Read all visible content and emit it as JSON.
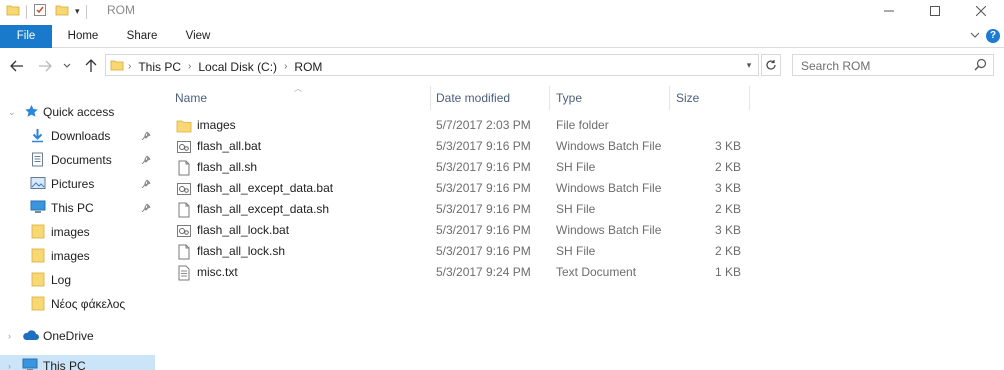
{
  "window": {
    "title": "ROM",
    "controls": [
      "minimize-icon",
      "maximize-icon",
      "close-icon"
    ]
  },
  "ribbon": {
    "tabs": [
      "File",
      "Home",
      "Share",
      "View"
    ]
  },
  "address": {
    "crumbs": [
      "This PC",
      "Local Disk (C:)",
      "ROM"
    ],
    "search_placeholder": "Search ROM"
  },
  "sidebar": {
    "items": [
      {
        "label": "Quick access",
        "icon": "star-icon",
        "pinned": false
      },
      {
        "label": "Downloads",
        "icon": "download-icon",
        "pinned": true
      },
      {
        "label": "Documents",
        "icon": "documents-icon",
        "pinned": true
      },
      {
        "label": "Pictures",
        "icon": "pictures-icon",
        "pinned": true
      },
      {
        "label": "This PC",
        "icon": "computer-icon",
        "pinned": true
      },
      {
        "label": "images",
        "icon": "folder-icon",
        "pinned": false
      },
      {
        "label": "images",
        "icon": "folder-icon",
        "pinned": false
      },
      {
        "label": "Log",
        "icon": "folder-icon",
        "pinned": false
      },
      {
        "label": "Νέος φάκελος",
        "icon": "folder-icon",
        "pinned": false
      },
      {
        "label": "OneDrive",
        "icon": "cloud-icon",
        "pinned": false
      },
      {
        "label": "This PC",
        "icon": "computer-icon",
        "pinned": false
      }
    ]
  },
  "columns": {
    "name": "Name",
    "date": "Date modified",
    "type": "Type",
    "size": "Size"
  },
  "files": [
    {
      "name": "images",
      "date": "5/7/2017 2:03 PM",
      "type": "File folder",
      "size": "",
      "icon": "folder-icon"
    },
    {
      "name": "flash_all.bat",
      "date": "5/3/2017 9:16 PM",
      "type": "Windows Batch File",
      "size": "3 KB",
      "icon": "batch-file-icon"
    },
    {
      "name": "flash_all.sh",
      "date": "5/3/2017 9:16 PM",
      "type": "SH File",
      "size": "2 KB",
      "icon": "file-icon"
    },
    {
      "name": "flash_all_except_data.bat",
      "date": "5/3/2017 9:16 PM",
      "type": "Windows Batch File",
      "size": "3 KB",
      "icon": "batch-file-icon"
    },
    {
      "name": "flash_all_except_data.sh",
      "date": "5/3/2017 9:16 PM",
      "type": "SH File",
      "size": "2 KB",
      "icon": "file-icon"
    },
    {
      "name": "flash_all_lock.bat",
      "date": "5/3/2017 9:16 PM",
      "type": "Windows Batch File",
      "size": "3 KB",
      "icon": "batch-file-icon"
    },
    {
      "name": "flash_all_lock.sh",
      "date": "5/3/2017 9:16 PM",
      "type": "SH File",
      "size": "2 KB",
      "icon": "file-icon"
    },
    {
      "name": "misc.txt",
      "date": "5/3/2017 9:24 PM",
      "type": "Text Document",
      "size": "1 KB",
      "icon": "text-file-icon"
    }
  ],
  "colors": {
    "accent": "#1979ca",
    "folder": "#f8d775",
    "header_text": "#4c607a",
    "selection": "#cce4f7"
  }
}
